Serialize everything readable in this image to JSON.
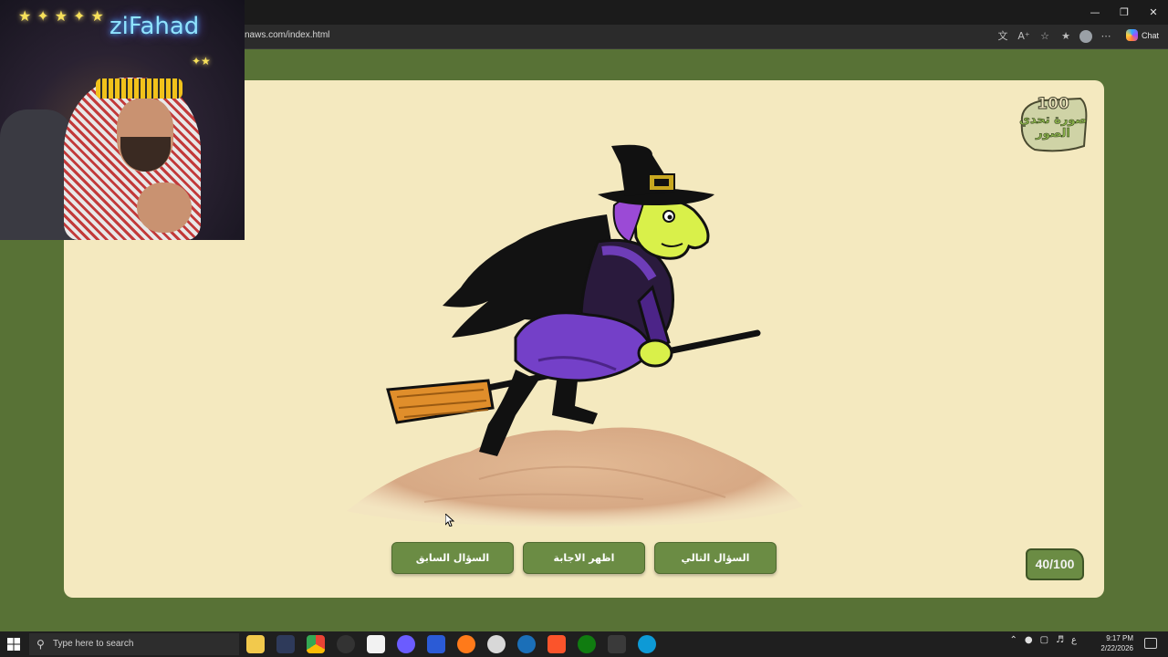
{
  "browser": {
    "url": "naws.com/index.html",
    "chat_label": "Chat",
    "window_controls": [
      "minimize-icon",
      "restore-icon",
      "close-icon"
    ],
    "address_icons": [
      "translate-icon",
      "read-aloud-icon",
      "favorite-icon",
      "favorites-bar-icon",
      "profile-icon",
      "more-icon"
    ]
  },
  "overlay": {
    "streamer_neon": "ziFahad"
  },
  "game": {
    "logo_number": "100",
    "logo_text": "صورة تحدي الصور",
    "image_subject": "witch-on-broomstick-over-sand",
    "buttons": {
      "previous": "السؤال السابق",
      "show_answer": "اظهر الاجابة",
      "next": "السؤال التالي"
    },
    "counter": "40/100",
    "progress": {
      "current": 40,
      "total": 100
    },
    "colors": {
      "page_bg": "#587236",
      "card_bg": "#f4e9bf",
      "button_bg": "#6b8c44"
    }
  },
  "taskbar": {
    "search_placeholder": "Type here to search",
    "time": "9:17 PM",
    "date": "2/22/2026",
    "input_language": "ع",
    "apps": [
      "file-explorer-icon",
      "app-icon",
      "chrome-icon",
      "obs-icon",
      "store-icon",
      "discord-icon",
      "word-icon",
      "firefox-icon",
      "app-icon",
      "steam-icon",
      "brave-icon",
      "xbox-icon",
      "app-icon",
      "edge-icon"
    ]
  }
}
